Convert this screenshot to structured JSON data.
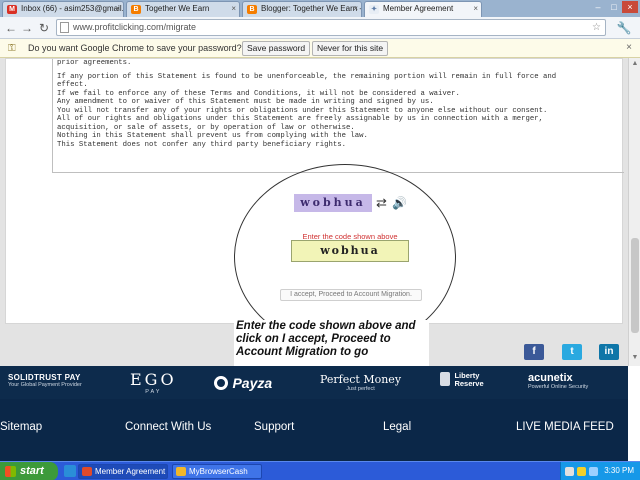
{
  "browser": {
    "tabs": [
      {
        "label": "Inbox (66) - asim253@gmail.c"
      },
      {
        "label": "Together We Earn"
      },
      {
        "label": "Blogger: Together We Earn -"
      },
      {
        "label": "Member Agreement"
      }
    ],
    "url": "www.profitclicking.com/migrate"
  },
  "password_bar": {
    "message": "Do you want Google Chrome to save your password?",
    "save_label": "Save password",
    "never_label": "Never for this site"
  },
  "terms": {
    "lines": [
      "prior agreements.",
      "",
      "If any portion of this Statement is found to be unenforceable, the remaining portion will remain in full force and",
      "effect.",
      "If we fail to enforce any of these Terms and Conditions, it will not be considered a waiver.",
      "Any amendment to or waiver of this Statement must be made in writing and signed by us.",
      "You will not transfer any of your rights or obligations under this Statement to anyone else without our consent.",
      "All of our rights and obligations under this Statement are freely assignable by us in connection with a merger,",
      "acquisition, or sale of assets, or by operation of law or otherwise.",
      "Nothing in this Statement shall prevent us from complying with the law.",
      "This Statement does not confer any third party beneficiary rights."
    ]
  },
  "captcha": {
    "image_text": "wobhua",
    "label": "Enter the code shown above",
    "input_value": "wobhua",
    "accept_label": "I accept, Proceed to Account Migration."
  },
  "annotation": {
    "text": "Enter the code shown above and click on I accept, Proceed to Account Migration to go"
  },
  "payment_logos": [
    {
      "main": "SOLIDTRUST PAY",
      "sub": "Your Global Payment Provider"
    },
    {
      "main": "EGO",
      "sub": "PAY"
    },
    {
      "main": "Payza",
      "sub": ""
    },
    {
      "main": "Perfect Money",
      "sub": "Just perfect"
    },
    {
      "main": "Liberty Reserve",
      "sub": ""
    },
    {
      "main": "acunetix",
      "sub": "Powerful Online Security"
    }
  ],
  "footer": {
    "links": [
      "Sitemap",
      "Connect With Us",
      "Support",
      "Legal",
      "LIVE MEDIA FEED"
    ]
  },
  "taskbar": {
    "start_label": "start",
    "tasks": [
      "Member Agreement - ...",
      "MyBrowserCash"
    ],
    "clock": "3:30 PM"
  },
  "colors": {
    "footer_bg": "#0b2748",
    "captcha_input_bg": "#f2f4b7",
    "captcha_label": "#d03232",
    "taskbar": "#2c5bd8",
    "start_button": "#3c9a3a"
  }
}
